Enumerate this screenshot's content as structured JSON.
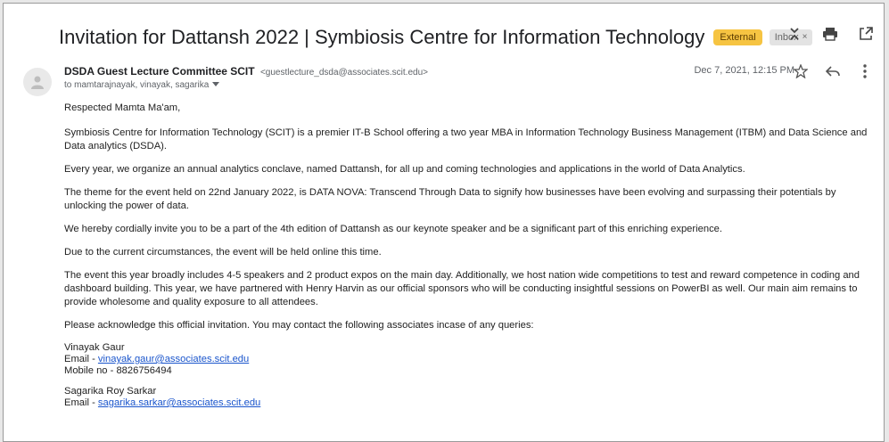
{
  "email": {
    "subject": "Invitation for Dattansh 2022 | Symbiosis Centre for Information Technology",
    "label_external": "External",
    "label_inbox": "Inbox",
    "sender_name": "DSDA Guest Lecture Committee SCIT",
    "sender_email": "<guestlecture_dsda@associates.scit.edu>",
    "recipients": "to mamtarajnayak, vinayak, sagarika",
    "date": "Dec 7, 2021, 12:15 PM",
    "greeting": "Respected Mamta Ma'am,",
    "paragraphs": [
      "Symbiosis Centre for Information Technology (SCIT) is a premier IT-B School offering a two year MBA in Information Technology Business Management (ITBM) and Data Science and Data analytics (DSDA).",
      "Every year, we organize an annual analytics conclave, named Dattansh, for all up and coming technologies and applications in the world of Data Analytics.",
      "The theme for the event held on 22nd January 2022, is DATA NOVA: Transcend Through Data to signify how businesses have been evolving and surpassing their potentials by unlocking the power of data.",
      "We hereby cordially invite you to be a part of the 4th edition of Dattansh as our keynote speaker and be a significant part of this enriching experience.",
      "Due to the current circumstances, the event will be held online this time.",
      "The event this year broadly includes 4-5 speakers and 2 product expos on the main day. Additionally, we host nation wide competitions to test and reward competence in coding and dashboard building. This year, we have partnered with Henry Harvin as our official sponsors who will be conducting insightful sessions on PowerBI as well. Our main aim remains to provide wholesome and quality exposure to all attendees.",
      "Please acknowledge this official invitation. You may contact the following associates incase of any queries:"
    ],
    "contacts": [
      {
        "name": "Vinayak Gaur",
        "email_label": "Email - ",
        "email": "vinayak.gaur@associates.scit.edu",
        "mobile": "Mobile no - 8826756494"
      },
      {
        "name": "Sagarika Roy Sarkar",
        "email_label": "Email - ",
        "email": "sagarika.sarkar@associates.scit.edu"
      }
    ]
  },
  "icons": {
    "collapse": "collapse-icon",
    "print": "print-icon",
    "new_window": "new-window-icon",
    "star": "star-icon",
    "reply": "reply-icon",
    "more": "more-vert-icon",
    "avatar": "person-icon"
  },
  "colors": {
    "external_badge": "#f6c442",
    "link": "#1a55cc"
  }
}
